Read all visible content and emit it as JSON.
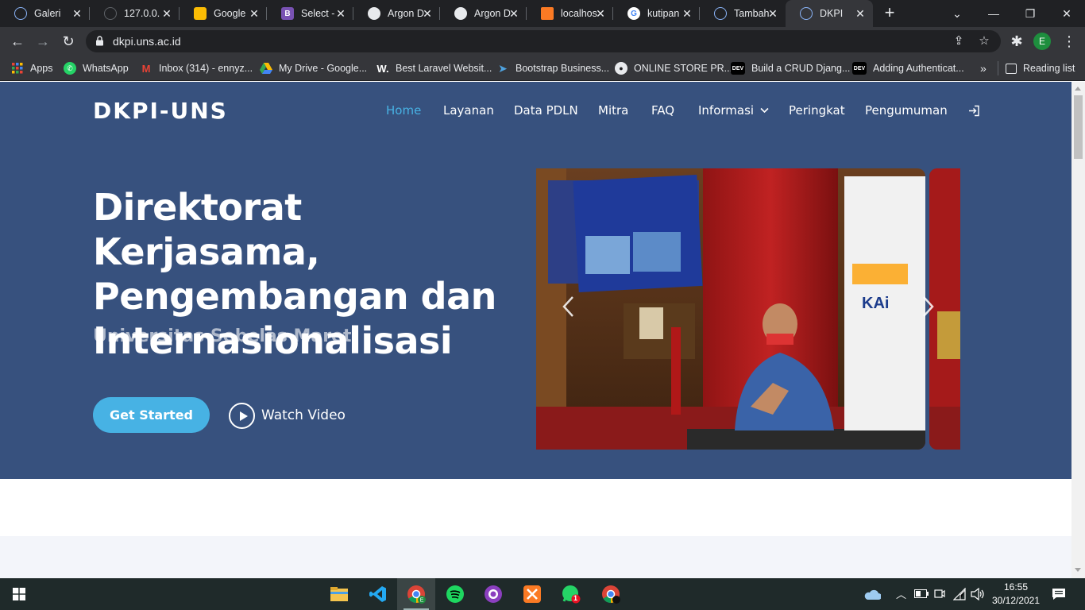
{
  "browser": {
    "tabs": [
      {
        "label": "Galeri",
        "icon": "globe-icon"
      },
      {
        "label": "127.0.0.",
        "icon": "globe-icon"
      },
      {
        "label": "Google ",
        "icon": "google-keep-icon"
      },
      {
        "label": "Select - ",
        "icon": "bootstrap-icon"
      },
      {
        "label": "Argon D",
        "icon": "argon-icon"
      },
      {
        "label": "Argon D",
        "icon": "argon-icon"
      },
      {
        "label": "localhos",
        "icon": "xampp-icon"
      },
      {
        "label": "kutipan",
        "icon": "google-icon"
      },
      {
        "label": "Tambah",
        "icon": "globe-icon"
      },
      {
        "label": "DKPI",
        "icon": "globe-icon"
      }
    ],
    "active_tab": "DKPI",
    "url": "dkpi.uns.ac.id",
    "profile_initial": "E",
    "bookmarks": [
      {
        "label": "Apps",
        "icon": "apps-grid-icon"
      },
      {
        "label": "WhatsApp",
        "icon": "whatsapp-icon"
      },
      {
        "label": "Inbox (314) - ennyz...",
        "icon": "gmail-icon"
      },
      {
        "label": "My Drive - Google...",
        "icon": "google-drive-icon"
      },
      {
        "label": "Best Laravel Websit...",
        "icon": "w-icon"
      },
      {
        "label": "Bootstrap Business...",
        "icon": "bootstrap-bird-icon"
      },
      {
        "label": "ONLINE STORE PR...",
        "icon": "github-icon"
      },
      {
        "label": "Build a CRUD Djang...",
        "icon": "dev-icon"
      },
      {
        "label": "Adding Authenticat...",
        "icon": "dev-icon"
      }
    ],
    "bookmarks_more": "»",
    "reading_list": "Reading list"
  },
  "site": {
    "brand": "DKPI-UNS",
    "nav": {
      "home": "Home",
      "layanan": "Layanan",
      "data_pdln": "Data PDLN",
      "mitra": "Mitra",
      "faq": "FAQ",
      "informasi": "Informasi",
      "peringkat": "Peringkat",
      "pengumuman": "Pengumuman"
    },
    "hero": {
      "title": "Direktorat Kerjasama, Pengembangan dan Internasionalisasi",
      "subtitle": "Universitas Sebelas Maret",
      "cta_primary": "Get Started",
      "cta_secondary": "Watch Video"
    },
    "carousel": {
      "prev_icon": "chevron-left-icon",
      "next_icon": "chevron-right-icon",
      "slide_image": "photo of official signing document at ceremony"
    }
  },
  "taskbar": {
    "apps": [
      "file-explorer-icon",
      "vscode-icon",
      "chrome-icon",
      "spotify-icon",
      "github-desktop-icon",
      "xampp-icon",
      "whatsapp-icon",
      "chrome-dark-icon"
    ],
    "whatsapp_badge": "1",
    "time": "16:55",
    "date": "30/12/2021"
  },
  "colors": {
    "hero_bg": "#37517e",
    "accent": "#47b2e4",
    "browser_dark": "#202124",
    "browser_toolbar": "#35363a",
    "taskbar": "#1f2a2a"
  }
}
